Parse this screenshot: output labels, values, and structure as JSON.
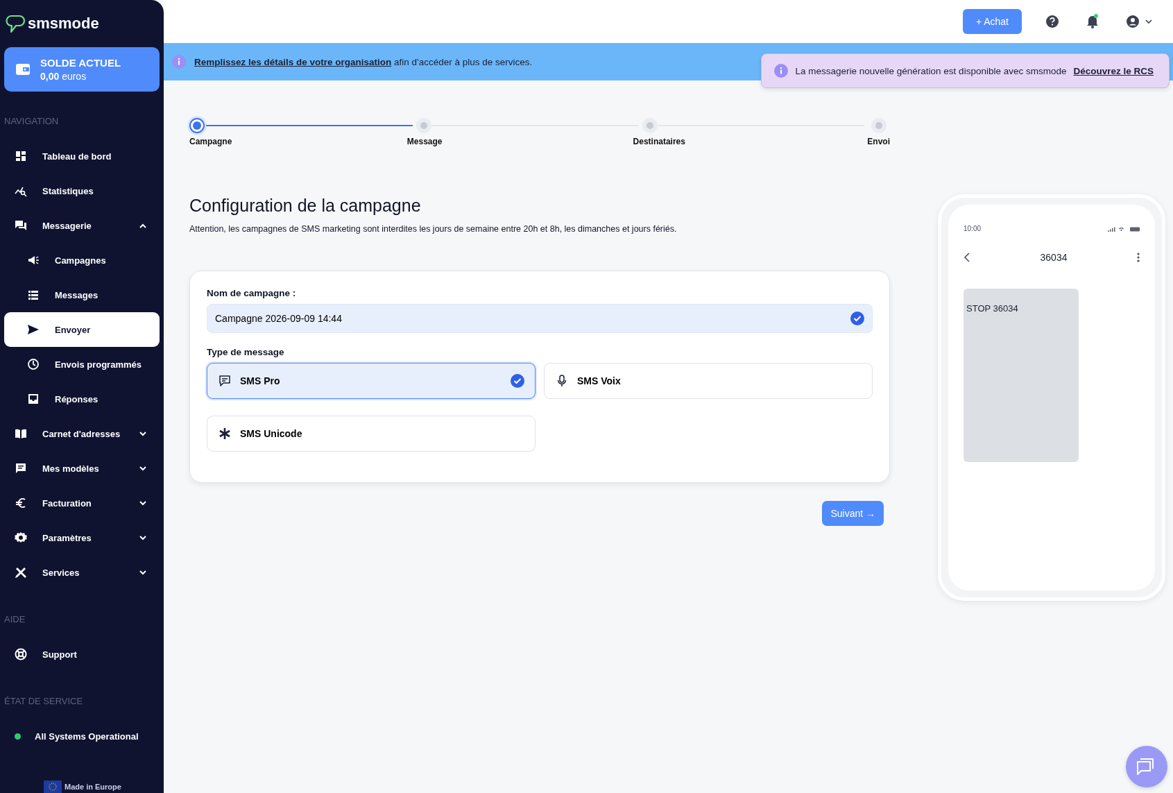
{
  "sidebar": {
    "logo": "smsmode",
    "balance": {
      "title": "SOLDE ACTUEL",
      "amount": "0,00",
      "unit": "euros"
    },
    "sections": [
      {
        "title": "NAVIGATION",
        "items": [
          {
            "label": "Tableau de bord",
            "selected": false
          },
          {
            "label": "Statistiques",
            "selected": false
          },
          {
            "label": "Messagerie",
            "selected": false,
            "expanded": true,
            "children": [
              {
                "label": "Campagnes",
                "selected": false
              },
              {
                "label": "Messages",
                "selected": false
              },
              {
                "label": "Envoyer",
                "selected": true
              },
              {
                "label": "Envois programmés",
                "selected": false
              },
              {
                "label": "Réponses",
                "selected": false
              }
            ]
          },
          {
            "label": "Carnet d'adresses",
            "selected": false,
            "expanded": false
          },
          {
            "label": "Mes modèles",
            "selected": false,
            "expanded": false
          },
          {
            "label": "Facturation",
            "selected": false,
            "expanded": false
          },
          {
            "label": "Paramètres",
            "selected": false,
            "expanded": false
          },
          {
            "label": "Services",
            "selected": false,
            "expanded": false
          }
        ]
      },
      {
        "title": "AIDE",
        "items": [
          {
            "label": "Support",
            "selected": false
          }
        ]
      }
    ],
    "status": {
      "title": "ÉTAT DE SERVICE",
      "label": "All Systems Operational",
      "color": "#2ecc71"
    },
    "footer": "Made in Europe"
  },
  "top_bar": {
    "buy_button": "+ Achat",
    "notifications_unread": true
  },
  "banner": {
    "link": "Remplissez les détails de votre organisation",
    "text": "afin d'accéder à plus de services."
  },
  "toast": {
    "text": "La messagerie nouvelle génération est disponible avec smsmode",
    "link": "Découvrez le RCS"
  },
  "steps": [
    {
      "label": "Campagne",
      "selected": true
    },
    {
      "label": "Message",
      "selected": false
    },
    {
      "label": "Destinataires",
      "selected": false
    },
    {
      "label": "Envoi",
      "selected": false
    }
  ],
  "title": "Configuration de la campagne",
  "notice": "Attention, les campagnes de SMS marketing sont interdites les jours de semaine entre 20h et 8h, les dimanches et jours fériés.",
  "form": {
    "name_label": "Nom de campagne :",
    "name_value": "Campagne 2026-09-09 14:44",
    "name_valid": true,
    "type_label": "Type de message",
    "types": [
      {
        "label": "SMS Pro",
        "selected": true
      },
      {
        "label": "SMS Voix",
        "selected": false
      },
      {
        "label": "SMS Unicode",
        "selected": false
      }
    ]
  },
  "next_button": "Suivant →",
  "phone": {
    "time": "10:00",
    "contact": "36034",
    "message": "STOP 36034"
  }
}
